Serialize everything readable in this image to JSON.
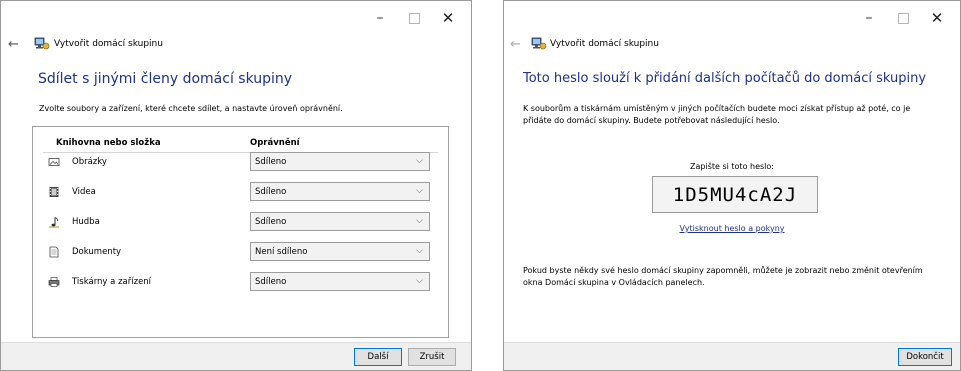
{
  "window1": {
    "app_title": "Vytvořit domácí skupinu",
    "heading": "Sdílet s jinými členy domácí skupiny",
    "description": "Zvolte soubory a zařízení, které chcete sdílet, a nastavte úroveň oprávnění.",
    "table": {
      "col_library": "Knihovna nebo složka",
      "col_permission": "Oprávnění",
      "rows": [
        {
          "label": "Obrázky",
          "icon": "pictures-icon",
          "value": "Sdíleno"
        },
        {
          "label": "Videa",
          "icon": "videos-icon",
          "value": "Sdíleno"
        },
        {
          "label": "Hudba",
          "icon": "music-icon",
          "value": "Sdíleno"
        },
        {
          "label": "Dokumenty",
          "icon": "documents-icon",
          "value": "Není sdíleno"
        },
        {
          "label": "Tiskárny a zařízení",
          "icon": "printer-icon",
          "value": "Sdíleno"
        }
      ]
    },
    "buttons": {
      "next": "Další",
      "cancel": "Zrušit"
    }
  },
  "window2": {
    "app_title": "Vytvořit domácí skupinu",
    "heading": "Toto heslo slouží k přidání dalších počítačů do domácí skupiny",
    "description": "K souborům a tiskárnám umístěným v jiných počítačích budete moci získat přístup až poté, co je přidáte do domácí skupiny. Budete potřebovat následující heslo.",
    "password_label": "Zapište si toto heslo:",
    "password": "1D5MU4cA2J",
    "print_link": "Vytisknout heslo a pokyny",
    "footer_note": "Pokud byste někdy své heslo domácí skupiny zapomněli, můžete je zobrazit nebo změnit otevřením okna Domácí skupina v Ovládacích panelech.",
    "buttons": {
      "finish": "Dokončit"
    }
  },
  "caption": {
    "minimize": "–",
    "close": "✕"
  },
  "back_glyph": "←",
  "chevron_glyph": "⌵",
  "colors": {
    "heading": "#1e3287",
    "accent": "#0078d7",
    "footer": "#f0f0f0"
  }
}
